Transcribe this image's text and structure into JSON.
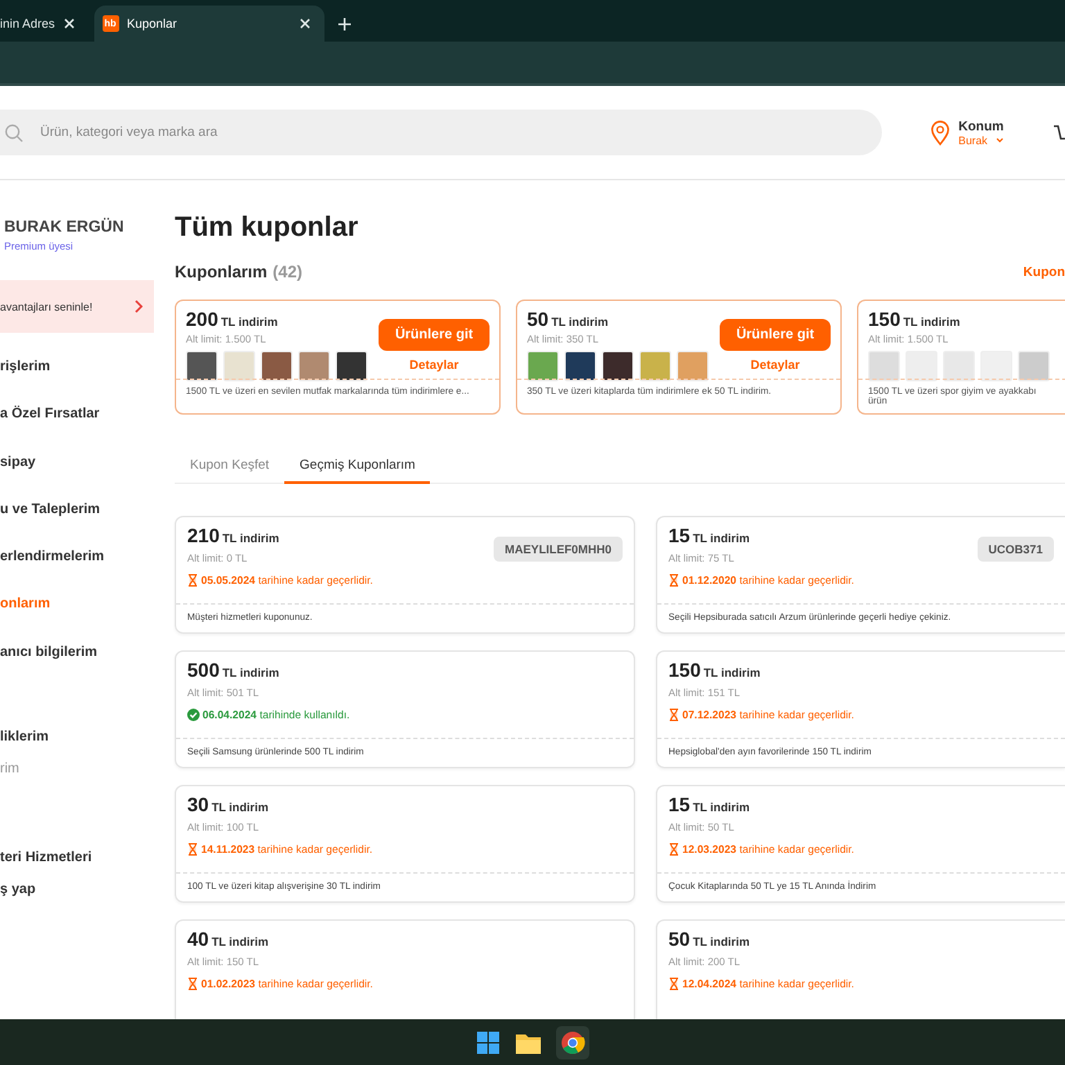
{
  "browser": {
    "tabs": [
      {
        "title": "inin Adres",
        "selected": false
      },
      {
        "title": "Kuponlar",
        "favicon": "hb",
        "selected": true
      }
    ]
  },
  "header": {
    "search": {
      "placeholder": "Ürün, kategori veya marka ara"
    },
    "location": {
      "label": "Konum",
      "value": "Burak"
    }
  },
  "sidebar": {
    "user": {
      "name": "BURAK ERGÜN",
      "membership": "Premium üyesi"
    },
    "promo": "avantajları seninle!",
    "items": [
      {
        "label": "rişlerim",
        "kind": "item",
        "selected": false
      },
      {
        "label": "a Özel Fırsatlar",
        "kind": "item",
        "selected": false
      },
      {
        "label": "sipay",
        "kind": "item",
        "selected": false
      },
      {
        "label": "u ve Taleplerim",
        "kind": "item",
        "selected": false
      },
      {
        "label": "erlendirmelerim",
        "kind": "item",
        "selected": false
      },
      {
        "label": "onlarım",
        "kind": "item",
        "selected": true
      },
      {
        "label": "anıcı bilgilerim",
        "kind": "item",
        "selected": false
      },
      {
        "label": "liklerim",
        "kind": "group",
        "selected": false
      },
      {
        "label": "rim",
        "kind": "sub",
        "selected": false
      },
      {
        "label": "teri Hizmetleri",
        "kind": "group",
        "selected": false
      },
      {
        "label": "ş yap",
        "kind": "item",
        "selected": false
      }
    ]
  },
  "main": {
    "title": "Tüm kuponlar",
    "section": {
      "title": "Kuponlarım",
      "count": "(42)",
      "link": "Kupon"
    },
    "active_coupons": [
      {
        "amount": "200",
        "unit": "TL indirim",
        "min": "Alt limit: 1.500 TL",
        "button": "Ürünlere git",
        "details": "Detaylar",
        "description": "1500 TL ve üzeri en sevilen mutfak markalarında tüm indirimlere e..."
      },
      {
        "amount": "50",
        "unit": "TL indirim",
        "min": "Alt limit: 350 TL",
        "button": "Ürünlere git",
        "details": "Detaylar",
        "description": "350 TL ve üzeri kitaplarda tüm indirimlere ek 50 TL indirim."
      },
      {
        "amount": "150",
        "unit": "TL indirim",
        "min": "Alt limit: 1.500 TL",
        "description": "1500 TL ve üzeri spor giyim ve ayakkabı ürün"
      }
    ],
    "tabs": [
      {
        "label": "Kupon Keşfet",
        "selected": false
      },
      {
        "label": "Geçmiş Kuponlarım",
        "selected": true
      }
    ],
    "coupons": [
      {
        "amount": "210",
        "unit": "TL indirim",
        "min": "Alt limit: 0 TL",
        "kind": "expired",
        "date": "05.05.2024",
        "status": "tarihine kadar geçerlidir.",
        "description": "Müşteri hizmetleri kuponunuz.",
        "code": "MAEYLILEF0MHH0"
      },
      {
        "amount": "15",
        "unit": "TL indirim",
        "min": "Alt limit: 75 TL",
        "kind": "expired",
        "date": "01.12.2020",
        "status": "tarihine kadar geçerlidir.",
        "description": "Seçili Hepsiburada satıcılı Arzum ürünlerinde geçerli hediye çekiniz.",
        "code": "UCOB371"
      },
      {
        "amount": "500",
        "unit": "TL indirim",
        "min": "Alt limit: 501 TL",
        "kind": "used",
        "date": "06.04.2024",
        "status": "tarihinde kullanıldı.",
        "description": "Seçili Samsung ürünlerinde 500 TL indirim"
      },
      {
        "amount": "150",
        "unit": "TL indirim",
        "min": "Alt limit: 151 TL",
        "kind": "expired",
        "date": "07.12.2023",
        "status": "tarihine kadar geçerlidir.",
        "description": "Hepsiglobal'den ayın favorilerinde 150 TL indirim"
      },
      {
        "amount": "30",
        "unit": "TL indirim",
        "min": "Alt limit: 100 TL",
        "kind": "expired",
        "date": "14.11.2023",
        "status": "tarihine kadar geçerlidir.",
        "description": "100 TL ve üzeri kitap alışverişine 30 TL indirim"
      },
      {
        "amount": "15",
        "unit": "TL indirim",
        "min": "Alt limit: 50 TL",
        "kind": "expired",
        "date": "12.03.2023",
        "status": "tarihine kadar geçerlidir.",
        "description": "Çocuk Kitaplarında 50 TL ye 15 TL Anında İndirim"
      },
      {
        "amount": "40",
        "unit": "TL indirim",
        "min": "Alt limit: 150 TL",
        "kind": "expired",
        "date": "01.02.2023",
        "status": "tarihine kadar geçerlidir."
      },
      {
        "amount": "50",
        "unit": "TL indirim",
        "min": "Alt limit: 200 TL",
        "kind": "expired",
        "date": "12.04.2024",
        "status": "tarihine kadar geçerlidir."
      }
    ]
  }
}
